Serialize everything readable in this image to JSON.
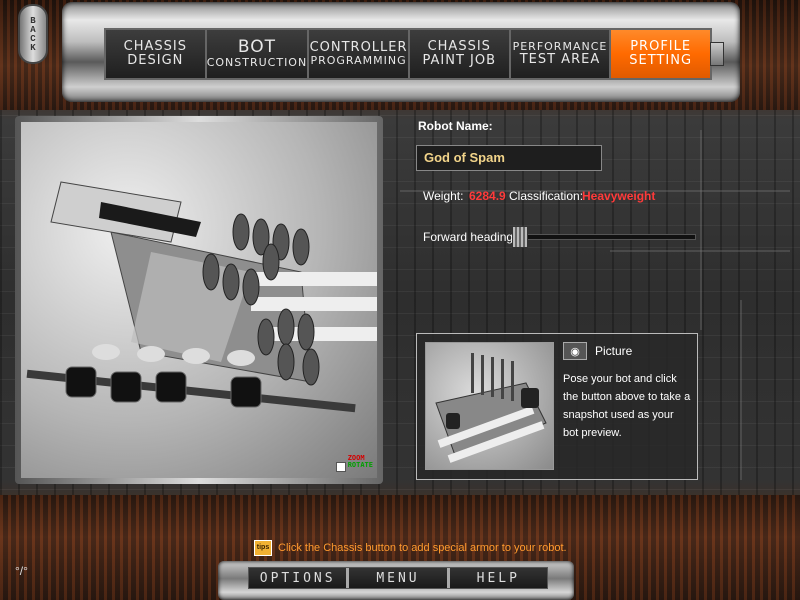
{
  "back": {
    "label": "BACK"
  },
  "nav": {
    "tabs": [
      {
        "line1": "CHASSIS",
        "line2": "DESIGN"
      },
      {
        "line1": "BOT",
        "line2": "CONSTRUCTION"
      },
      {
        "line1": "CONTROLLER",
        "line2": "PROGRAMMING"
      },
      {
        "line1": "CHASSIS",
        "line2": "PAINT JOB"
      },
      {
        "line1": "PERFORMANCE",
        "line2": "TEST AREA"
      },
      {
        "line1": "PROFILE",
        "line2": "SETTING"
      }
    ],
    "active_index": 5,
    "active_color": "#ff6a00"
  },
  "viewport": {
    "zoom_hint": "ZOOM",
    "rotate_hint": "ROTATE"
  },
  "profile": {
    "robot_name_label": "Robot Name:",
    "robot_name_value": "God of Spam",
    "weight_label": "Weight:",
    "weight_value": "6284.9",
    "classification_label": "Classification:",
    "classification_value": "Heavyweight",
    "forward_heading_label": "Forward heading:"
  },
  "picture": {
    "title": "Picture",
    "description": "Pose your bot and click the button above to take a snapshot used as your bot preview.",
    "camera_icon": "camera-icon"
  },
  "tip": {
    "icon_text": "tips",
    "text": "Click the Chassis button to add special armor to your robot."
  },
  "bottom": {
    "options_label": "OPTIONS",
    "menu_label": "MENU",
    "help_label": "HELP"
  },
  "colors": {
    "accent": "#ff6a00",
    "value_red": "#ff3a3a",
    "name_text": "#f2d48a",
    "tip_text": "#ff9a2e"
  }
}
